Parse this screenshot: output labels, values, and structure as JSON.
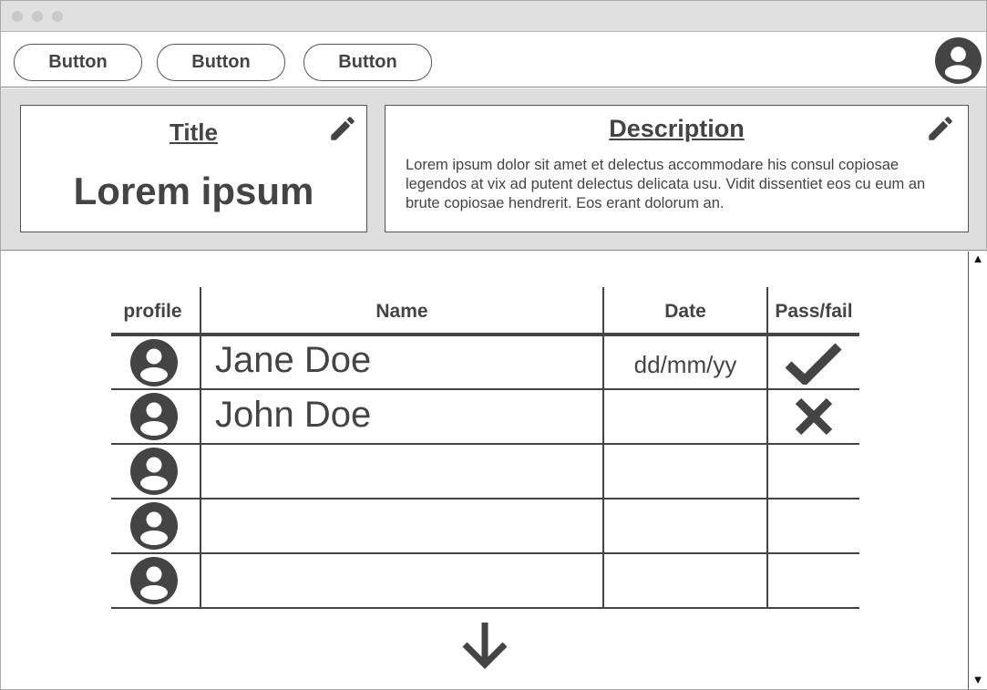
{
  "toolbar": {
    "buttons": [
      {
        "label": "Button"
      },
      {
        "label": "Button"
      },
      {
        "label": "Button"
      }
    ],
    "account_icon": "user-circle-icon"
  },
  "title_card": {
    "heading": "Title",
    "value": "Lorem ipsum",
    "edit_icon": "pencil-icon"
  },
  "description_card": {
    "heading": "Description",
    "text": "Lorem ipsum dolor sit amet et delectus accommodare his consul copiosae legendos at vix ad putent delectus delicata usu. Vidit dissentiet eos cu eum an brute copiosae hendrerit. Eos erant dolorum an.",
    "edit_icon": "pencil-icon"
  },
  "table": {
    "columns": [
      "profile",
      "Name",
      "Date",
      "Pass/fail"
    ],
    "rows": [
      {
        "name": "Jane Doe",
        "date": "dd/mm/yy",
        "result": "pass"
      },
      {
        "name": "John Doe",
        "date": "",
        "result": "fail"
      },
      {
        "name": "",
        "date": "",
        "result": ""
      },
      {
        "name": "",
        "date": "",
        "result": ""
      },
      {
        "name": "",
        "date": "",
        "result": ""
      }
    ]
  },
  "icons": {
    "avatar": "user-circle-icon",
    "pass": "checkmark-icon",
    "fail": "x-mark-icon",
    "more": "arrow-down-icon"
  },
  "scrollbar": {
    "up": "▲",
    "down": "▼"
  },
  "colors": {
    "ink": "#444444",
    "band": "#dedede",
    "titlebar": "#e0e0e0"
  }
}
